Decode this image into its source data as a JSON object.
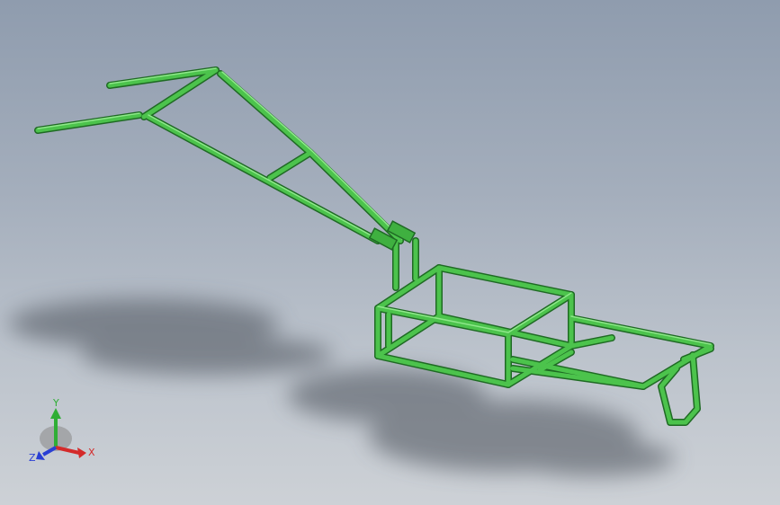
{
  "viewport": {
    "background_top": "#8f9cae",
    "background_bottom": "#cdd1d6"
  },
  "model": {
    "frame_color": "#4cc34c",
    "frame_dark": "#1f6a24",
    "frame_light": "#8ee88a"
  },
  "triad": {
    "x_label": "X",
    "y_label": "Y",
    "z_label": "Z",
    "x_color": "#d42a2a",
    "y_color": "#2fae35",
    "z_color": "#2a3fd4"
  }
}
